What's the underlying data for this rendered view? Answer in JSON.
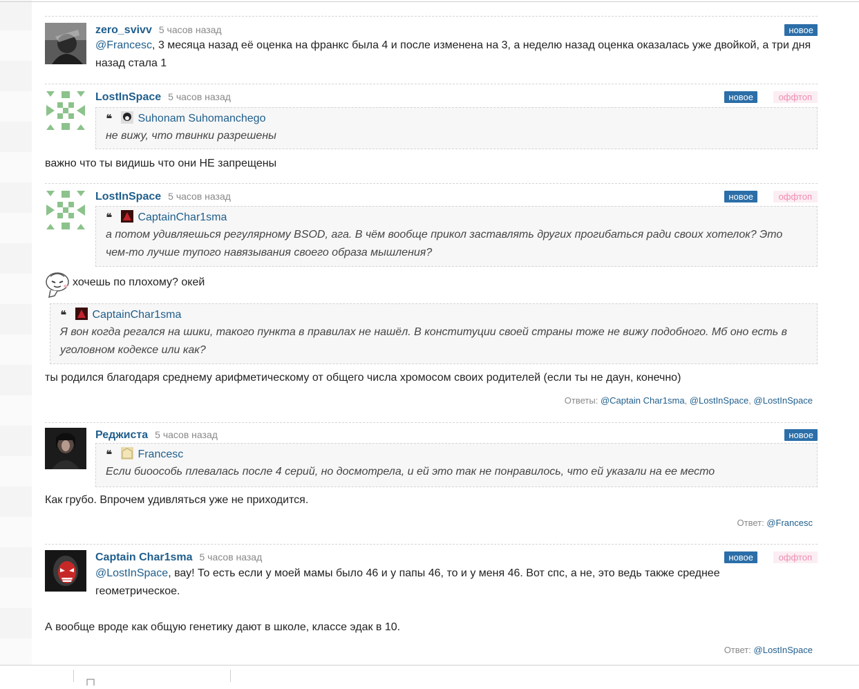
{
  "comments": [
    {
      "author": "zero_svivv",
      "time": "5 часов назад",
      "badge_new": "новое",
      "mention": "@Francesc",
      "text": ", 3 месяца назад её оценка на франкс была 4 и после изменена на 3, а неделю назад оценка оказалась уже двойкой, а три дня назад стала 1"
    },
    {
      "author": "LostInSpace",
      "time": "5 часов назад",
      "badge_new": "новое",
      "badge_offtopic": "оффтоп",
      "quote_author": "Suhonam Suhomanchego",
      "quote_text": "не вижу, что твинки разрешены",
      "text": "важно что ты видишь что они НЕ запрещены"
    },
    {
      "author": "LostInSpace",
      "time": "5 часов назад",
      "badge_new": "новое",
      "badge_offtopic": "оффтоп",
      "quote_author": "CaptainChar1sma",
      "quote_text": "а потом удивляешься регулярному BSOD, ага. В чём вообще прикол заставлять других прогибаться ради своих хотелок? Это чем-то лучше тупого навязывания своего образа мышления?",
      "text_after_smiley": "хочешь по плохому? окей",
      "quote2_author": "CaptainChar1sma",
      "quote2_text": "Я вон когда регался на шики, такого пункта в правилах не нашёл. В конституции своей страны тоже не вижу подобного. Мб оно есть в уголовном кодексе или как?",
      "text2": "ты родился благодаря среднему арифметическому от общего числа хромосом своих родителей (если ты не даун, конечно)",
      "replies_label": "Ответы:",
      "replies": [
        "@Captain Char1sma",
        "@LostInSpace",
        "@LostInSpace"
      ]
    },
    {
      "author": "Реджиста",
      "time": "5 часов назад",
      "badge_new": "новое",
      "quote_author": "Francesc",
      "quote_text": "Если биоособь плевалась после 4 серий, но досмотрела, и ей это так не понравилось, что ей указали на ее место",
      "text": "Как грубо. Впрочем удивляться уже не приходится.",
      "replies_label": "Ответ:",
      "replies": [
        "@Francesc"
      ]
    },
    {
      "author": "Captain Char1sma",
      "time": "5 часов назад",
      "badge_new": "новое",
      "badge_offtopic": "оффтоп",
      "mention": "@LostInSpace",
      "text": ", вау! То есть если у моей мамы было 46 и у папы 46, то и у меня 46. Вот спс, а не, это ведь также среднее геометрическое.",
      "text2": "А вообще вроде как общую генетику дают в школе, классе эдак в 10.",
      "replies_label": "Ответ:",
      "replies": [
        "@LostInSpace"
      ]
    }
  ],
  "colors": {
    "link": "#1f5e8c",
    "badge_new_bg": "#2b6ea8",
    "offtopic_text": "#f08bb0",
    "offtopic_bg": "#fbeef3",
    "quote_bg": "#f7f7f7"
  }
}
